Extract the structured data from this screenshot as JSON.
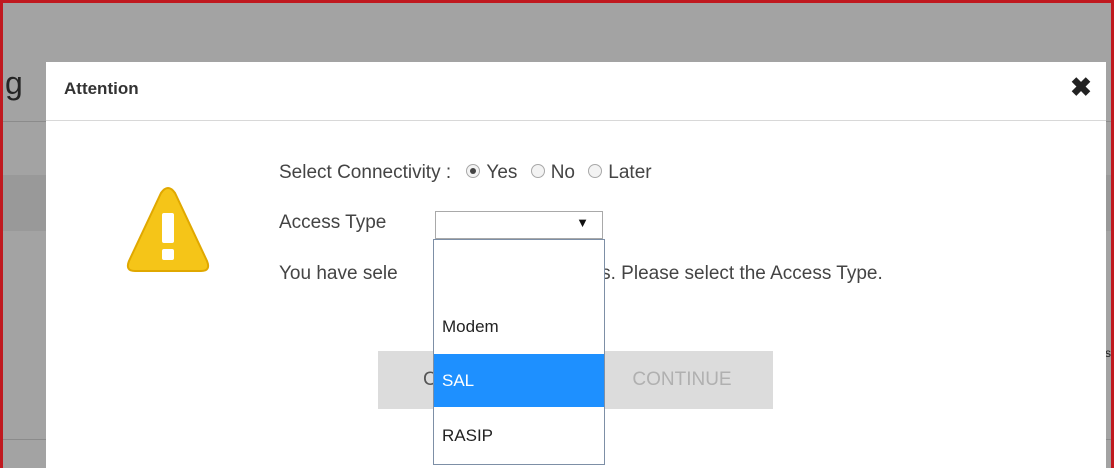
{
  "background": {
    "heading_fragment": "g",
    "right_fragment": "s"
  },
  "dialog": {
    "title": "Attention",
    "close_glyph": "✖",
    "connectivity": {
      "label": "Select Connectivity :",
      "options": [
        "Yes",
        "No",
        "Later"
      ],
      "selected": "Yes"
    },
    "access_type": {
      "label": "Access Type",
      "value": "",
      "arrow": "▼",
      "options": [
        "",
        "Modem",
        "SAL",
        "RASIP"
      ],
      "highlighted": "SAL"
    },
    "message": {
      "before": "You have sele",
      "after": "ity Yes. Please select the Access Type."
    },
    "buttons": {
      "cancel_fragment": "C",
      "continue": "CONTINUE"
    }
  },
  "colors": {
    "frame_border": "#c0191f",
    "highlight": "#1e90ff",
    "warning": "#f5c518"
  },
  "icons": {
    "warning": "warning-triangle-icon",
    "close": "close-icon"
  }
}
